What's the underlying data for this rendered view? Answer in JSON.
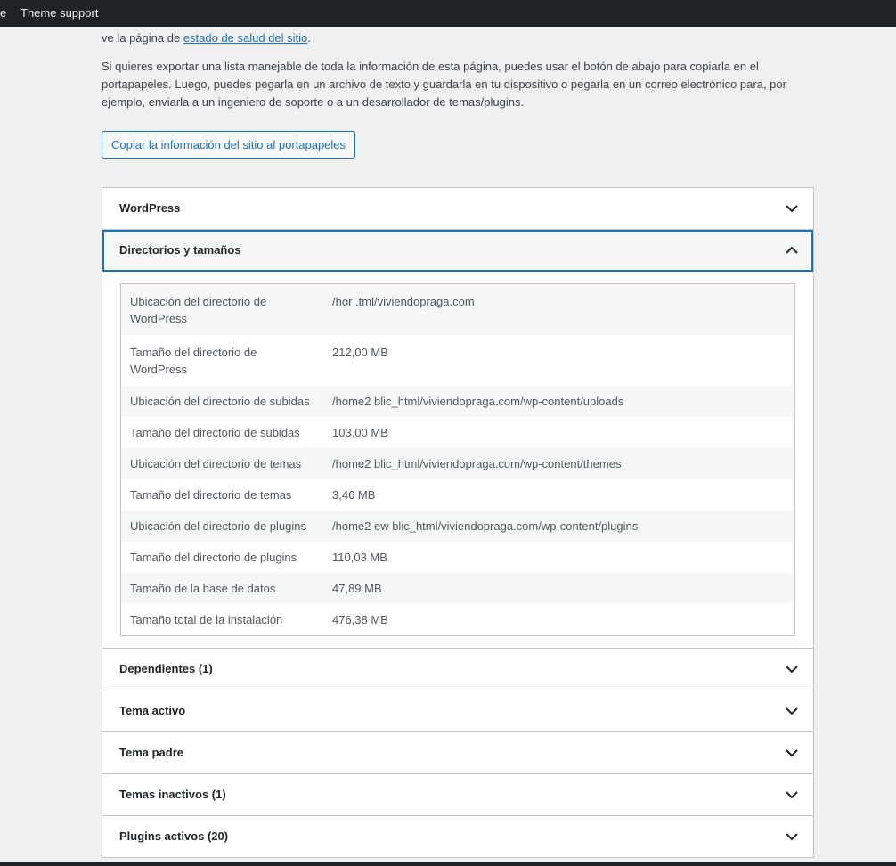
{
  "adminbar": {
    "left_fragment": "e",
    "theme_support": "Theme support"
  },
  "intro": {
    "line1_prefix": "ve la página de ",
    "health_link": "estado de salud del sitio",
    "line1_suffix": ".",
    "paragraph2": "Si quieres exportar una lista manejable de toda la información de esta página, puedes usar el botón de abajo para copiarla en el portapapeles. Luego, puedes pegarla en un archivo de texto y guardarla en tu dispositivo o pegarla en un correo electrónico para, por ejemplo, enviarla a un ingeniero de soporte o a un desarrollador de temas/plugins."
  },
  "copy_button": "Copiar la información del sitio al portapapeles",
  "sections": {
    "wordpress": "WordPress",
    "directories": "Directorios y tamaños",
    "dependents": "Dependientes (1)",
    "active_theme": "Tema activo",
    "parent_theme": "Tema padre",
    "inactive_themes": "Temas inactivos (1)",
    "active_plugins": "Plugins activos (20)"
  },
  "directories_table": [
    {
      "label": "Ubicación del directorio de WordPress",
      "value": "/hor                               .tml/viviendopraga.com"
    },
    {
      "label": "Tamaño del directorio de WordPress",
      "value": "212,00 MB"
    },
    {
      "label": "Ubicación del directorio de subidas",
      "value": "/home2                   blic_html/viviendopraga.com/wp-content/uploads"
    },
    {
      "label": "Tamaño del directorio de subidas",
      "value": "103,00 MB"
    },
    {
      "label": "Ubicación del directorio de temas",
      "value": "/home2                     blic_html/viviendopraga.com/wp-content/themes"
    },
    {
      "label": "Tamaño del directorio de temas",
      "value": "3,46 MB"
    },
    {
      "label": "Ubicación del directorio de plugins",
      "value": "/home2     ew            blic_html/viviendopraga.com/wp-content/plugins"
    },
    {
      "label": "Tamaño del directorio de plugins",
      "value": "110,03 MB"
    },
    {
      "label": "Tamaño de la base de datos",
      "value": "47,89 MB"
    },
    {
      "label": "Tamaño total de la instalación",
      "value": "476,38 MB"
    }
  ],
  "icons": {
    "collapsed": "chevron-down-icon",
    "expanded": "chevron-up-icon"
  },
  "colors": {
    "accent": "#2271b1",
    "adminbar": "#1d2327",
    "background": "#f0f0f1"
  }
}
